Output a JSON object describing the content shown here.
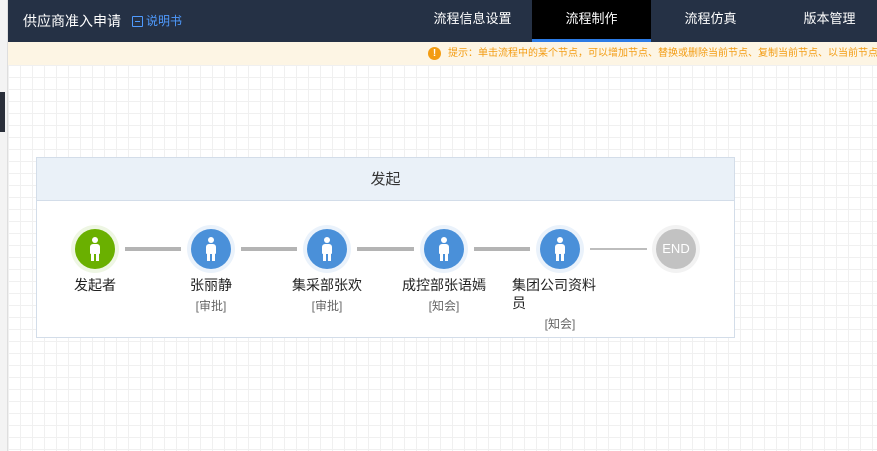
{
  "header": {
    "app_title": "供应商准入申请",
    "manual_label": "说明书",
    "tabs": [
      {
        "label": "流程信息设置",
        "active": false
      },
      {
        "label": "流程制作",
        "active": true
      },
      {
        "label": "流程仿真",
        "active": false
      },
      {
        "label": "版本管理",
        "active": false
      }
    ]
  },
  "tip": {
    "icon": "info-icon",
    "text": "提示：单击流程中的某个节点，可以增加节点、替换或删除当前节点、复制当前节点、以当前节点为"
  },
  "flow": {
    "title": "发起",
    "nodes": [
      {
        "name": "发起者",
        "role": "",
        "type": "start",
        "color": "#6ab000"
      },
      {
        "name": "张丽静",
        "role": "[审批]",
        "type": "user",
        "color": "#4a90d9"
      },
      {
        "name": "集采部张欢",
        "role": "[审批]",
        "type": "user",
        "color": "#4a90d9"
      },
      {
        "name": "成控部张语嫣",
        "role": "[知会]",
        "type": "user",
        "color": "#4a90d9"
      },
      {
        "name": "集团公司资料员",
        "role": "[知会]",
        "type": "user",
        "color": "#4a90d9"
      }
    ],
    "end_label": "END"
  }
}
